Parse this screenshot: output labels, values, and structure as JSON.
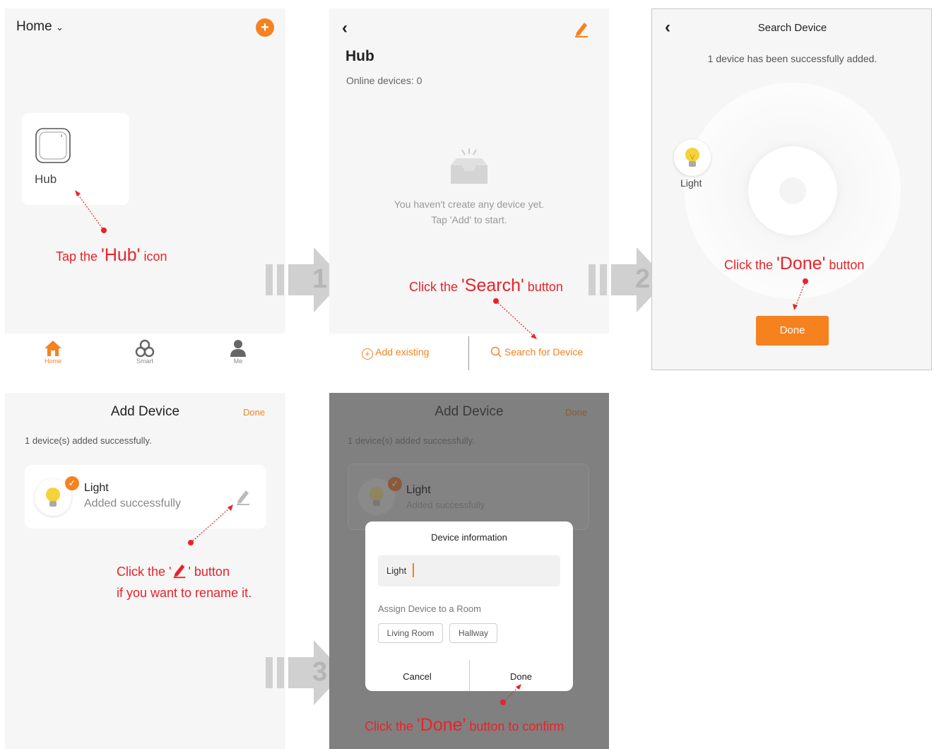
{
  "screen1": {
    "home_label": "Home",
    "hub_label": "Hub",
    "instr_pre": "Tap the ",
    "instr_key": "'Hub'",
    "instr_post": " icon",
    "tabs": [
      {
        "label": "Home",
        "icon": "home-icon"
      },
      {
        "label": "Smart",
        "icon": "smart-icon"
      },
      {
        "label": "Me",
        "icon": "person-icon"
      }
    ]
  },
  "screen2": {
    "title": "Hub",
    "online": "Online devices: 0",
    "empty_line1": "You haven't create any device yet.",
    "empty_line2": "Tap 'Add' to start.",
    "instr_pre": "Click the ",
    "instr_key": "'Search'",
    "instr_post": " button",
    "add_existing": "Add existing",
    "search_device": "Search for Device"
  },
  "screen3": {
    "title": "Search Device",
    "status": "1 device has been successfully added.",
    "device_label": "Light",
    "instr_pre": "Click the ",
    "instr_key": "'Done'",
    "instr_post": " button",
    "done_label": "Done"
  },
  "screen4": {
    "title": "Add Device",
    "done_link": "Done",
    "status": "1 device(s) added successfully.",
    "device_name": "Light",
    "device_status": "Added successfully",
    "instr_line1_pre": "Click the '",
    "instr_line1_post": "' button",
    "instr_line2": "if you want to rename it."
  },
  "screen5": {
    "title": "Add Device",
    "done_link": "Done",
    "status": "1 device(s) added successfully.",
    "device_name": "Light",
    "device_status": "Added successfully",
    "dialog_title": "Device information",
    "name_value": "Light",
    "assign_label": "Assign Device to a Room",
    "rooms": [
      "Living Room",
      "Hallway"
    ],
    "cancel": "Cancel",
    "done": "Done",
    "instr_pre": "Click the ",
    "instr_key": "'Done'",
    "instr_post": " button to confirm"
  },
  "steps": [
    "1",
    "2",
    "3"
  ],
  "colors": {
    "accent": "#f5821f",
    "instruction": "#e8232a",
    "overlay": "#808080"
  }
}
